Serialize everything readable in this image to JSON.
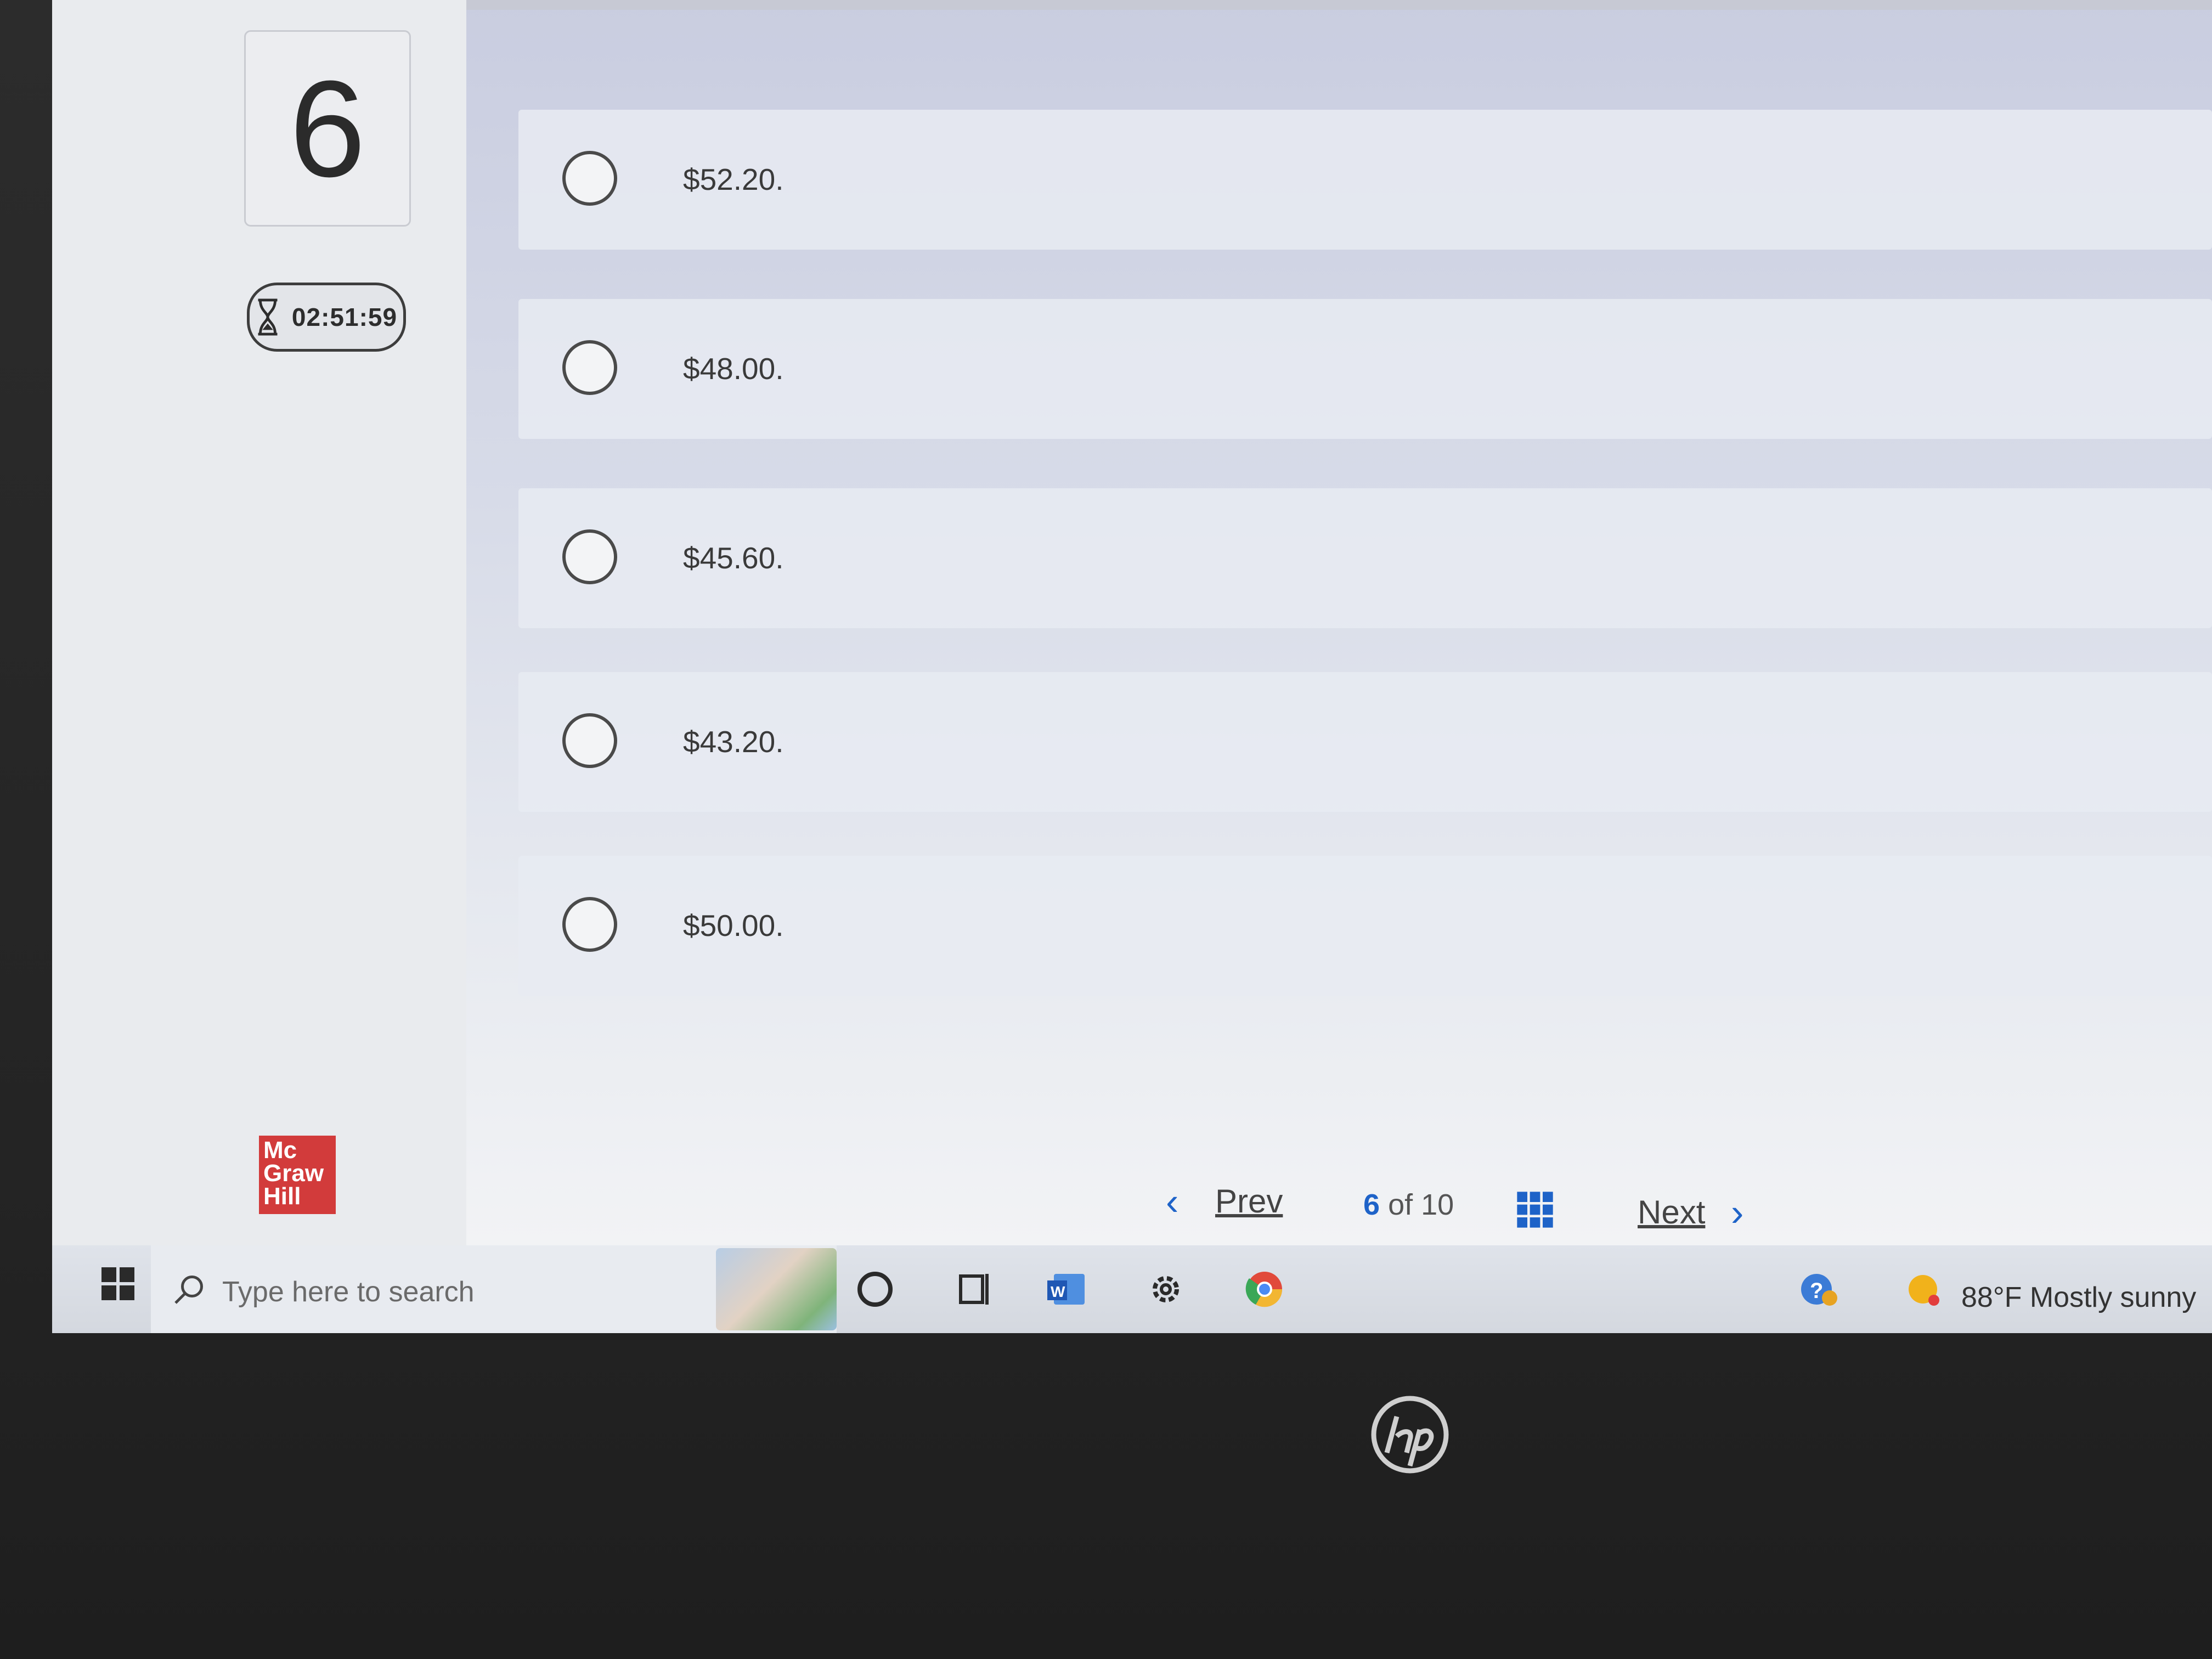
{
  "question": {
    "number": "6",
    "timer": "02:51:59"
  },
  "options": [
    {
      "label": "$52.20."
    },
    {
      "label": "$48.00."
    },
    {
      "label": "$45.60."
    },
    {
      "label": "$43.20."
    },
    {
      "label": "$50.00."
    }
  ],
  "footer": {
    "logo_lines": [
      "Mc",
      "Graw",
      "Hill"
    ],
    "prev_label": "Prev",
    "page_current": "6",
    "page_of": "of 10",
    "next_label": "Next"
  },
  "taskbar": {
    "search_placeholder": "Type here to search",
    "weather": "88°F  Mostly sunny"
  },
  "colors": {
    "accent": "#1e63c8",
    "logo_red": "#d23b3b"
  }
}
